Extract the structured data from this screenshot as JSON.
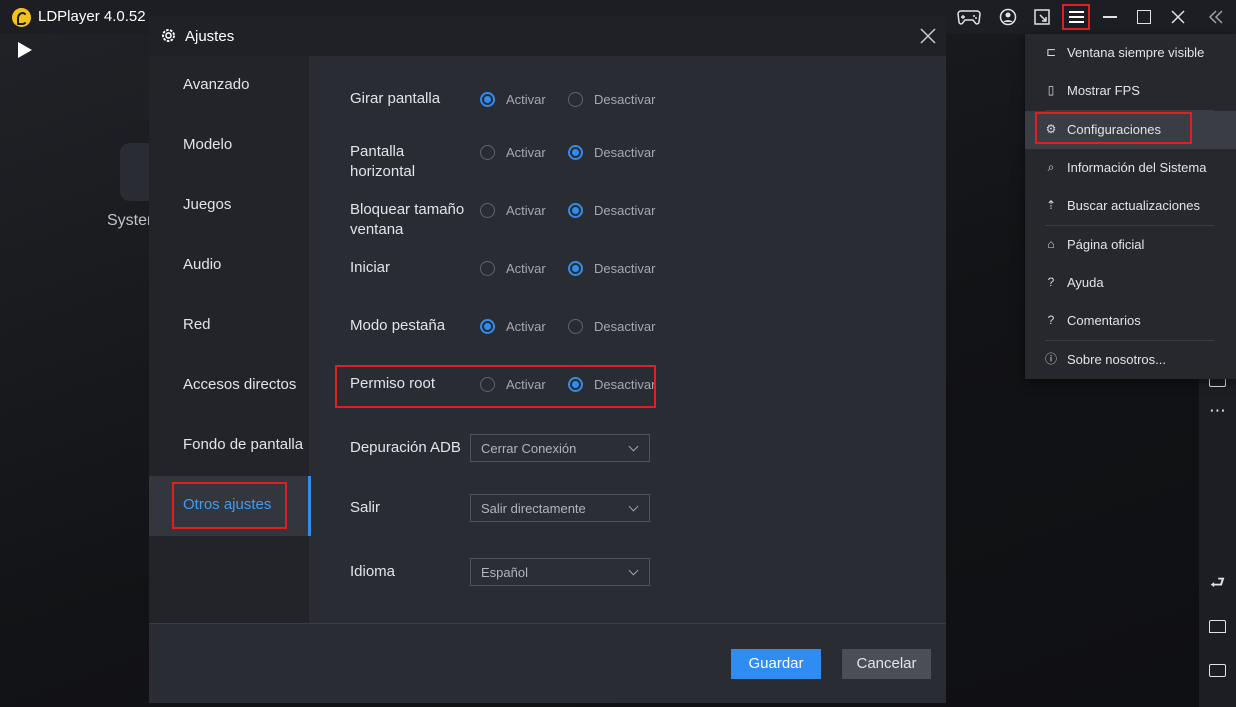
{
  "app": {
    "title": "LDPlayer 4.0.52"
  },
  "android": {
    "app_label": "Syster"
  },
  "dialog": {
    "title": "Ajustes",
    "nav": [
      {
        "label": "Avanzado",
        "active": false
      },
      {
        "label": "Modelo",
        "active": false
      },
      {
        "label": "Juegos",
        "active": false
      },
      {
        "label": "Audio",
        "active": false
      },
      {
        "label": "Red",
        "active": false
      },
      {
        "label": "Accesos directos",
        "active": false
      },
      {
        "label": "Fondo de pantalla",
        "active": false
      },
      {
        "label": "Otros ajustes",
        "active": true
      }
    ],
    "settings": [
      {
        "label": "Girar pantalla",
        "on": "Activar",
        "off": "Desactivar",
        "selected": "on"
      },
      {
        "label": "Pantalla horizontal",
        "on": "Activar",
        "off": "Desactivar",
        "selected": "off"
      },
      {
        "label": "Bloquear tamaño ventana",
        "on": "Activar",
        "off": "Desactivar",
        "selected": "off"
      },
      {
        "label": "Iniciar",
        "on": "Activar",
        "off": "Desactivar",
        "selected": "off"
      },
      {
        "label": "Modo pestaña",
        "on": "Activar",
        "off": "Desactivar",
        "selected": "on"
      },
      {
        "label": "Permiso root",
        "on": "Activar",
        "off": "Desactivar",
        "selected": "off"
      }
    ],
    "selects": [
      {
        "label": "Depuración ADB",
        "value": "Cerrar Conexión"
      },
      {
        "label": "Salir",
        "value": "Salir directamente"
      },
      {
        "label": "Idioma",
        "value": "Español"
      }
    ],
    "save_label": "Guardar",
    "cancel_label": "Cancelar"
  },
  "menu": {
    "items": [
      {
        "label": "Ventana siempre visible",
        "icon": "pin-icon"
      },
      {
        "label": "Mostrar FPS",
        "icon": "fps-icon"
      },
      {
        "label": "Configuraciones",
        "icon": "gear-icon",
        "active": true
      },
      {
        "label": "Información del Sistema",
        "icon": "search-icon"
      },
      {
        "label": "Buscar actualizaciones",
        "icon": "upload-icon"
      },
      {
        "label": "Página oficial",
        "icon": "home-icon"
      },
      {
        "label": "Ayuda",
        "icon": "help-icon"
      },
      {
        "label": "Comentarios",
        "icon": "feedback-icon"
      },
      {
        "label": "Sobre nosotros...",
        "icon": "info-icon"
      }
    ]
  },
  "colors": {
    "accent": "#2f8cf0",
    "highlight": "#e02020",
    "brand": "#f6c219"
  }
}
